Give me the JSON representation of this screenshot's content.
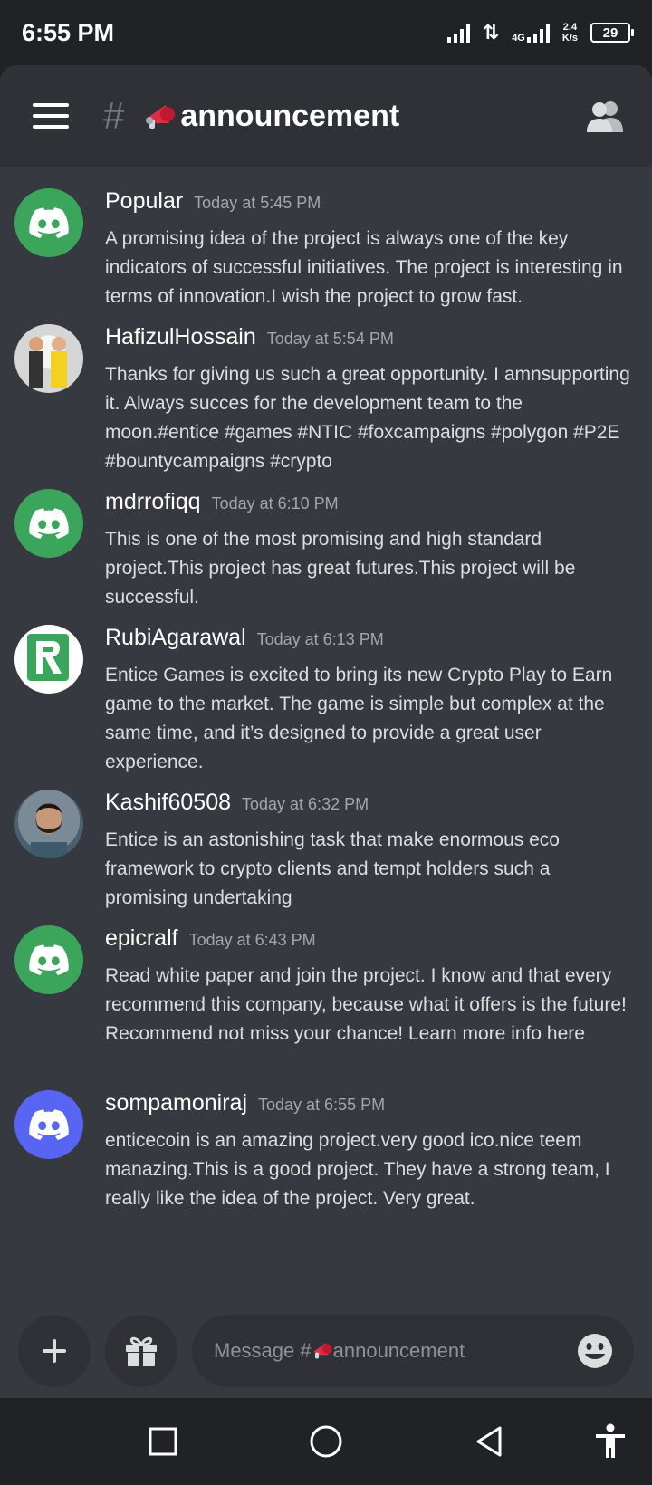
{
  "status": {
    "time": "6:55 PM",
    "net_speed_value": "2.4",
    "net_speed_unit": "K/s",
    "network_type": "4G",
    "battery": "29"
  },
  "channel": {
    "hash": "#",
    "name": "announcement"
  },
  "messages": [
    {
      "username": "Popular",
      "timestamp": "Today at 5:45 PM",
      "text": "A promising idea of the project is always one of the key indicators of successful initiatives. The project is interesting in terms of innovation.I wish the project to grow fast.",
      "avatar": "discord-default-green"
    },
    {
      "username": "HafizulHossain",
      "timestamp": "Today at 5:54 PM",
      "text": "Thanks for giving us such a great opportunity. I amnsupporting it. Always succes for the development team to the moon.#entice #games #NTIC #foxcampaigns #polygon #P2E #bountycampaigns #crypto",
      "avatar": "photo"
    },
    {
      "username": "mdrrofiqq",
      "timestamp": "Today at 6:10 PM",
      "text": "This is one of the most promising and high standard project.This project has great futures.This project will be successful.",
      "avatar": "discord-default-green"
    },
    {
      "username": "RubiAgarawal",
      "timestamp": "Today at 6:13 PM",
      "text": "Entice Games is excited to bring its new Crypto Play to Earn game to the market. The game is simple but complex at the same time, and it’s designed to provide a great user experience.",
      "avatar": "r-logo"
    },
    {
      "username": "Kashif60508",
      "timestamp": "Today at 6:32 PM",
      "text": "Entice is an astonishing task that make enormous eco framework to crypto clients and tempt holders such a promising undertaking",
      "avatar": "photo"
    },
    {
      "username": "epicralf",
      "timestamp": "Today at 6:43 PM",
      "text": "Read white paper and join the project. I know and that every recommend this company, because what it offers is the future! Recommend not miss your chance! Learn more info here",
      "avatar": "discord-default-green"
    },
    {
      "username": "sompamoniraj",
      "timestamp": "Today at 6:55 PM",
      "text": "enticecoin is an amazing project.very good ico.nice teem manazing.This is a good project. They have a strong team, I really like the idea of the project. Very great.",
      "avatar": "discord-default-blurple"
    }
  ],
  "composer": {
    "placeholder_prefix": "Message #",
    "placeholder_channel": "announcement"
  },
  "colors": {
    "background": "#36393f",
    "header": "#2f3136",
    "system_bar": "#202225",
    "avatar_green": "#3ba55c",
    "avatar_blurple": "#5865f2"
  },
  "icons": [
    "hamburger-menu-icon",
    "megaphone-icon",
    "members-icon",
    "plus-icon",
    "gift-icon",
    "emoji-icon",
    "recents-icon",
    "home-icon",
    "back-icon",
    "accessibility-icon"
  ]
}
